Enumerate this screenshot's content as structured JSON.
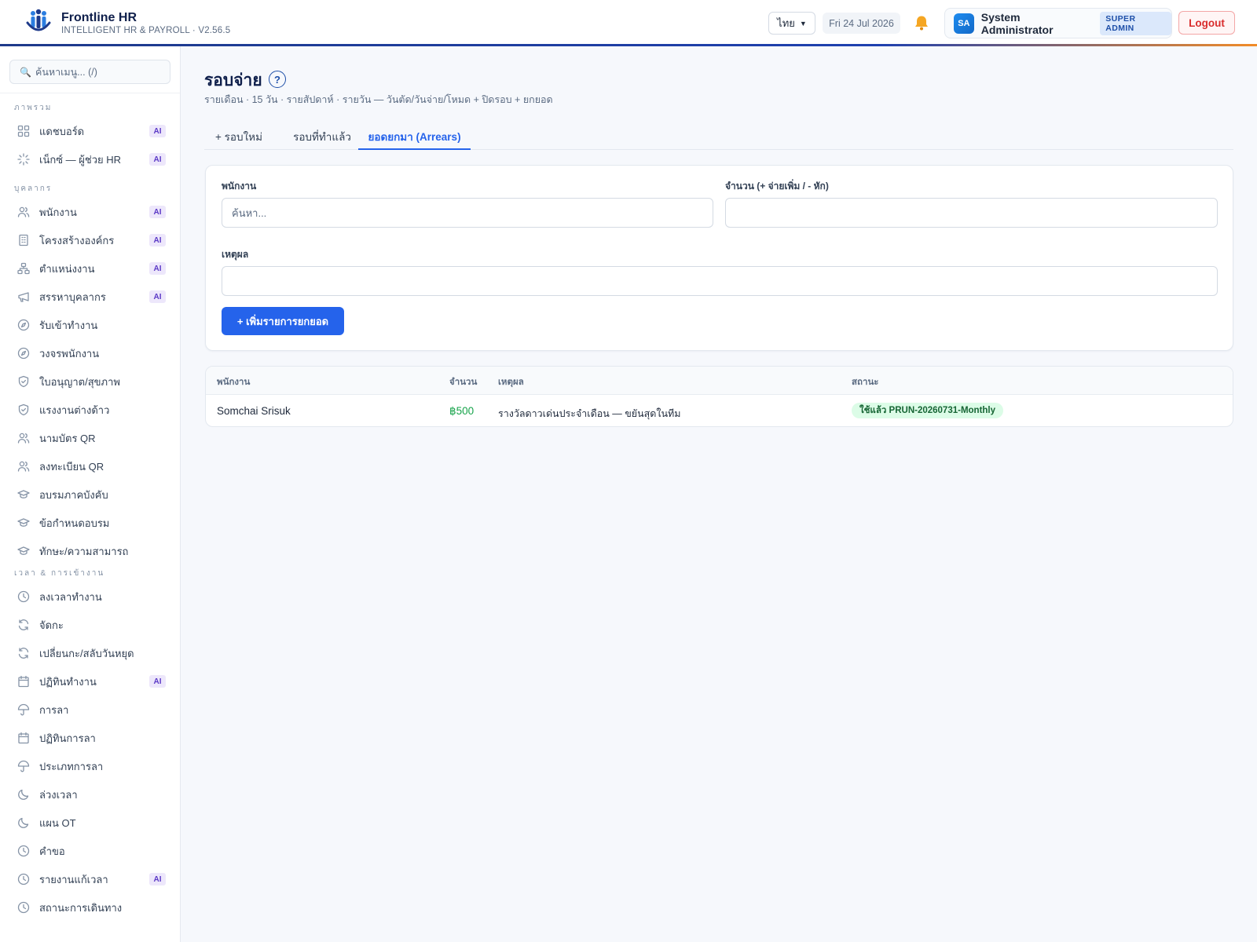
{
  "app": {
    "name": "Frontline HR",
    "subtitle": "INTELLIGENT HR & PAYROLL · V2.56.5"
  },
  "header": {
    "language": "ไทย",
    "date": "Fri 24 Jul 2026",
    "user": {
      "initials": "SA",
      "name": "System Administrator",
      "role": "SUPER ADMIN"
    },
    "logout_label": "Logout",
    "accent_color": "#f28c28",
    "brand_color": "#1e3a8a"
  },
  "sidebar": {
    "search_placeholder": "ค้นหาเมนู... (/)",
    "ai_badge": "AI",
    "groups": [
      {
        "label": "ภาพรวม",
        "items": [
          {
            "label": "แดชบอร์ด",
            "icon": "grid-icon",
            "ai": true
          },
          {
            "label": "เน็กซ์ — ผู้ช่วย HR",
            "icon": "sparkle-icon",
            "ai": true
          }
        ]
      },
      {
        "label": "บุคลากร",
        "items": [
          {
            "label": "พนักงาน",
            "icon": "users-icon",
            "ai": true
          },
          {
            "label": "โครงสร้างองค์กร",
            "icon": "building-icon",
            "ai": true
          },
          {
            "label": "ตำแหน่งงาน",
            "icon": "org-chart-icon",
            "ai": true
          },
          {
            "label": "สรรหาบุคลากร",
            "icon": "megaphone-icon",
            "ai": true
          },
          {
            "label": "รับเข้าทำงาน",
            "icon": "compass-icon",
            "ai": false
          },
          {
            "label": "วงจรพนักงาน",
            "icon": "compass-icon",
            "ai": false
          },
          {
            "label": "ใบอนุญาต/สุขภาพ",
            "icon": "shield-icon",
            "ai": false
          },
          {
            "label": "แรงงานต่างด้าว",
            "icon": "shield-icon",
            "ai": false
          },
          {
            "label": "นามบัตร QR",
            "icon": "users-icon",
            "ai": false
          },
          {
            "label": "ลงทะเบียน QR",
            "icon": "users-icon",
            "ai": false
          },
          {
            "label": "อบรมภาคบังคับ",
            "icon": "graduation-cap-icon",
            "ai": false
          },
          {
            "label": "ข้อกำหนดอบรม",
            "icon": "graduation-cap-icon",
            "ai": false
          },
          {
            "label": "ทักษะ/ความสามารถ",
            "icon": "graduation-cap-icon",
            "ai": false
          }
        ]
      },
      {
        "label": "เวลา & การเข้างาน",
        "items": [
          {
            "label": "ลงเวลาทำงาน",
            "icon": "clock-icon",
            "ai": false
          },
          {
            "label": "จัดกะ",
            "icon": "refresh-icon",
            "ai": false
          },
          {
            "label": "เปลี่ยนกะ/สลับวันหยุด",
            "icon": "refresh-icon",
            "ai": false
          },
          {
            "label": "ปฏิทินทำงาน",
            "icon": "calendar-icon",
            "ai": true
          },
          {
            "label": "การลา",
            "icon": "umbrella-icon",
            "ai": false
          },
          {
            "label": "ปฏิทินการลา",
            "icon": "calendar-icon",
            "ai": false
          },
          {
            "label": "ประเภทการลา",
            "icon": "umbrella-icon",
            "ai": false
          },
          {
            "label": "ล่วงเวลา",
            "icon": "moon-icon",
            "ai": false
          },
          {
            "label": "แผน OT",
            "icon": "moon-icon",
            "ai": false
          },
          {
            "label": "คำขอ",
            "icon": "clock-icon",
            "ai": false
          },
          {
            "label": "รายงานแก้เวลา",
            "icon": "clock-icon",
            "ai": true
          },
          {
            "label": "สถานะการเดินทาง",
            "icon": "clock-icon",
            "ai": false
          }
        ]
      }
    ]
  },
  "page": {
    "title": "รอบจ่าย",
    "help": "?",
    "subtitle": "รายเดือน · 15 วัน · รายสัปดาห์ · รายวัน — วันตัด/วันจ่าย/โหมด + ปิดรอบ + ยกยอด",
    "tabs": [
      {
        "label": "+ รอบใหม่",
        "active": false
      },
      {
        "label": "รอบที่ทำแล้ว",
        "active": false
      },
      {
        "label": "ยอดยกมา (Arrears)",
        "active": true
      }
    ]
  },
  "form": {
    "employee_label": "พนักงาน",
    "employee_placeholder": "ค้นหา...",
    "employee_value": "",
    "amount_label": "จำนวน (+ จ่ายเพิ่ม / - หัก)",
    "amount_value": "",
    "reason_label": "เหตุผล",
    "reason_value": "",
    "submit_label": "+ เพิ่มรายการยกยอด"
  },
  "table": {
    "columns": [
      "พนักงาน",
      "จำนวน",
      "เหตุผล",
      "สถานะ"
    ],
    "rows": [
      {
        "employee": "Somchai Srisuk",
        "amount": "฿500",
        "reason": "รางวัลดาวเด่นประจำเดือน — ขยันสุดในทีม",
        "status": "ใช้แล้ว PRUN-20260731-Monthly"
      }
    ]
  }
}
